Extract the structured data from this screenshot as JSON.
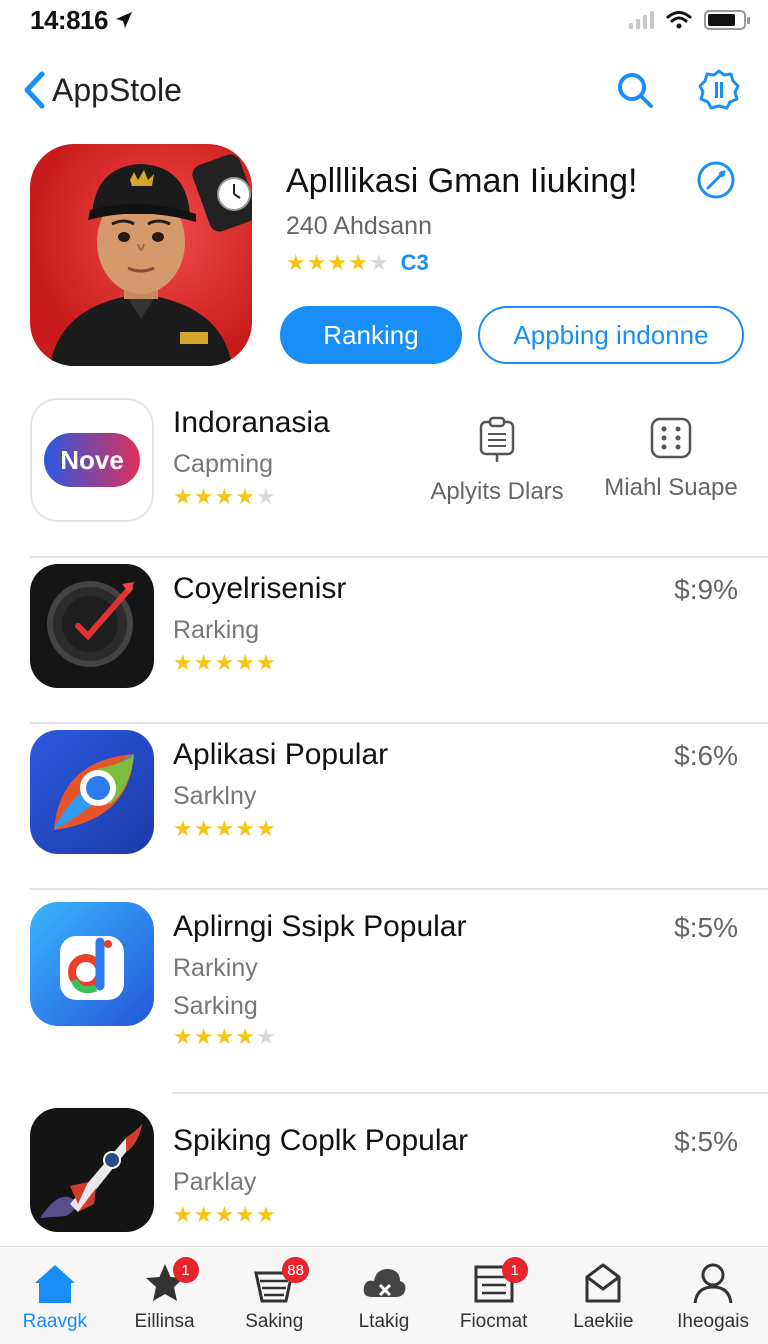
{
  "status_bar": {
    "time": "14:816"
  },
  "nav": {
    "back_label": "AppStole"
  },
  "featured": {
    "title": "Aplllikasi Gman Iiuking!",
    "subtitle": "240 Ahdsann",
    "rating": 3.5,
    "rating_tag": "C3",
    "primary_button": "Ranking",
    "secondary_button": "Appbing indonne"
  },
  "list": [
    {
      "title": "Indoranasia",
      "subtitle": "Capming",
      "rating": 3.5,
      "icon_text": "Nove",
      "actions": [
        {
          "label": "Aplyits Dlars",
          "icon": "clipboard-icon"
        },
        {
          "label": "Miahl Suape",
          "icon": "dice-grid-icon"
        }
      ]
    },
    {
      "title": "Coyelrisenisr",
      "subtitle": "Rarking",
      "rating": 4.5,
      "price": "$:9%"
    },
    {
      "title": "Aplikasi Popular",
      "subtitle": "Sarklny",
      "rating": 4.5,
      "price": "$:6%"
    },
    {
      "title": "Aplirngi Ssipk Popular",
      "subtitle": "Rarkiny",
      "subtitle2": "Sarking",
      "rating": 3.5,
      "price": "$:5%"
    },
    {
      "title": "Spiking Coplk Popular",
      "subtitle": "Parklay",
      "rating": 4.5,
      "price": "$:5%"
    }
  ],
  "tabs": [
    {
      "label": "Raavgk",
      "icon": "home-icon",
      "active": true
    },
    {
      "label": "Eillinsa",
      "icon": "star-icon",
      "badge": "1"
    },
    {
      "label": "Saking",
      "icon": "stack-icon",
      "badge": "88"
    },
    {
      "label": "Ltakig",
      "icon": "cloud-icon"
    },
    {
      "label": "Fiocmat",
      "icon": "list-icon",
      "badge": "1"
    },
    {
      "label": "Laekiie",
      "icon": "box-icon"
    },
    {
      "label": "Iheogais",
      "icon": "person-icon"
    }
  ],
  "colors": {
    "accent": "#1a8ef7",
    "star": "#f5c518",
    "badge": "#e8242e"
  }
}
